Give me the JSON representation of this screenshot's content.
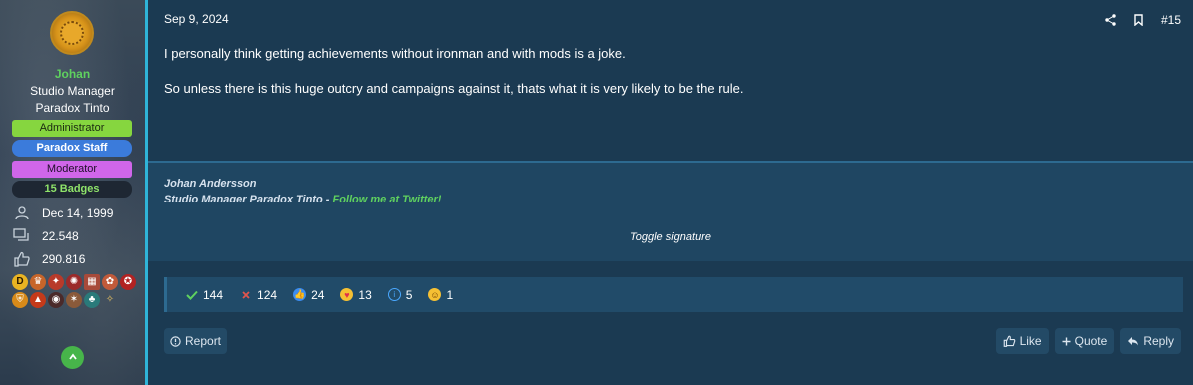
{
  "user": {
    "name": "Johan",
    "title": "Studio Manager",
    "studio": "Paradox Tinto",
    "banners": [
      "Administrator",
      "Paradox Staff",
      "Moderator",
      "15 Badges"
    ],
    "joined": "Dec 14, 1999",
    "messages": "22.548",
    "reactions": "290.816",
    "avatar_icon": "gold-medallion-icon"
  },
  "post": {
    "date": "Sep 9, 2024",
    "number": "#15",
    "paragraphs": [
      "I personally think getting achievements without ironman and with mods is a joke.",
      "So unless there is this huge outcry and campaigns against it, thats what it is very likely to be the rule."
    ]
  },
  "signature": {
    "name": "Johan Andersson",
    "line2_prefix": "Studio Manager Paradox Tinto - ",
    "line2_link": "Follow me at Twitter!",
    "toggle_label": "Toggle signature"
  },
  "reactions": [
    {
      "icon": "check-icon",
      "count": "144",
      "color": "#5fd15f"
    },
    {
      "icon": "cross-icon",
      "count": "124",
      "color": "#e0554d"
    },
    {
      "icon": "thumbs-up-icon",
      "count": "24",
      "color": "#3b8cf0"
    },
    {
      "icon": "heart-eyes-icon",
      "count": "13",
      "color": "#f5c033"
    },
    {
      "icon": "info-icon",
      "count": "5",
      "color": "#4aa8ff"
    },
    {
      "icon": "laugh-icon",
      "count": "1",
      "color": "#f5c033"
    }
  ],
  "actions": {
    "report": "Report",
    "like": "Like",
    "quote": "Quote",
    "reply": "Reply"
  },
  "colors": {
    "accent": "#2fb4d8",
    "username": "#5fd15f",
    "admin": "#86d63f",
    "staff": "#3b7bdb",
    "moderator": "#d066ea"
  }
}
